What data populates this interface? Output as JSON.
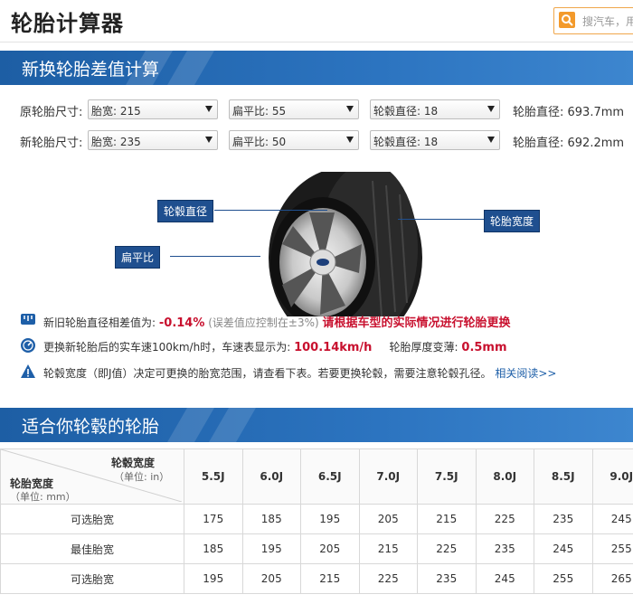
{
  "app": {
    "title": "轮胎计算器",
    "search_placeholder": "搜汽车，用"
  },
  "section1": {
    "title": "新换轮胎差值计算"
  },
  "original": {
    "label": "原轮胎尺寸:",
    "width": "胎宽: 215",
    "ratio": "扁平比: 55",
    "rim": "轮毂直径: 18",
    "diameter": "轮胎直径: 693.7mm"
  },
  "new": {
    "label": "新轮胎尺寸:",
    "width": "胎宽: 235",
    "ratio": "扁平比: 50",
    "rim": "轮毂直径: 18",
    "diameter": "轮胎直径: 692.2mm"
  },
  "diagram": {
    "rim_label": "轮毂直径",
    "width_label": "轮胎宽度",
    "ratio_label": "扁平比"
  },
  "info": {
    "diff_prefix": "新旧轮胎直径相差值为:",
    "diff_value": "-0.14%",
    "diff_note": "(误差值应控制在±3%)",
    "diff_warning": "请根据车型的实际情况进行轮胎更换",
    "speed_prefix": "更换新轮胎后的实车速100km/h时，车速表显示为:",
    "speed_value": "100.14km/h",
    "thick_prefix": "轮胎厚度变薄:",
    "thick_value": "0.5mm",
    "rim_note": "轮毂宽度（即J值）决定可更换的胎宽范围，请查看下表。若要更换轮毂，需要注意轮毂孔径。",
    "read_more": "相关阅读>>"
  },
  "section2": {
    "title": "适合你轮毂的轮胎"
  },
  "table": {
    "corner_top_title": "轮毂宽度",
    "corner_top_unit": "（单位: in）",
    "corner_left_title": "轮胎宽度",
    "corner_left_unit": "（单位: mm）",
    "columns": [
      "5.5J",
      "6.0J",
      "6.5J",
      "7.0J",
      "7.5J",
      "8.0J",
      "8.5J",
      "9.0J"
    ],
    "rows": [
      {
        "label": "可选胎宽",
        "values": [
          "175",
          "185",
          "195",
          "205",
          "215",
          "225",
          "235",
          "245"
        ]
      },
      {
        "label": "最佳胎宽",
        "values": [
          "185",
          "195",
          "205",
          "215",
          "225",
          "235",
          "245",
          "255"
        ]
      },
      {
        "label": "可选胎宽",
        "values": [
          "195",
          "205",
          "215",
          "225",
          "235",
          "245",
          "255",
          "265"
        ]
      }
    ]
  },
  "colors": {
    "accent": "#2c74c0",
    "warn": "#c8102e",
    "tag": "#1f4f8f"
  }
}
